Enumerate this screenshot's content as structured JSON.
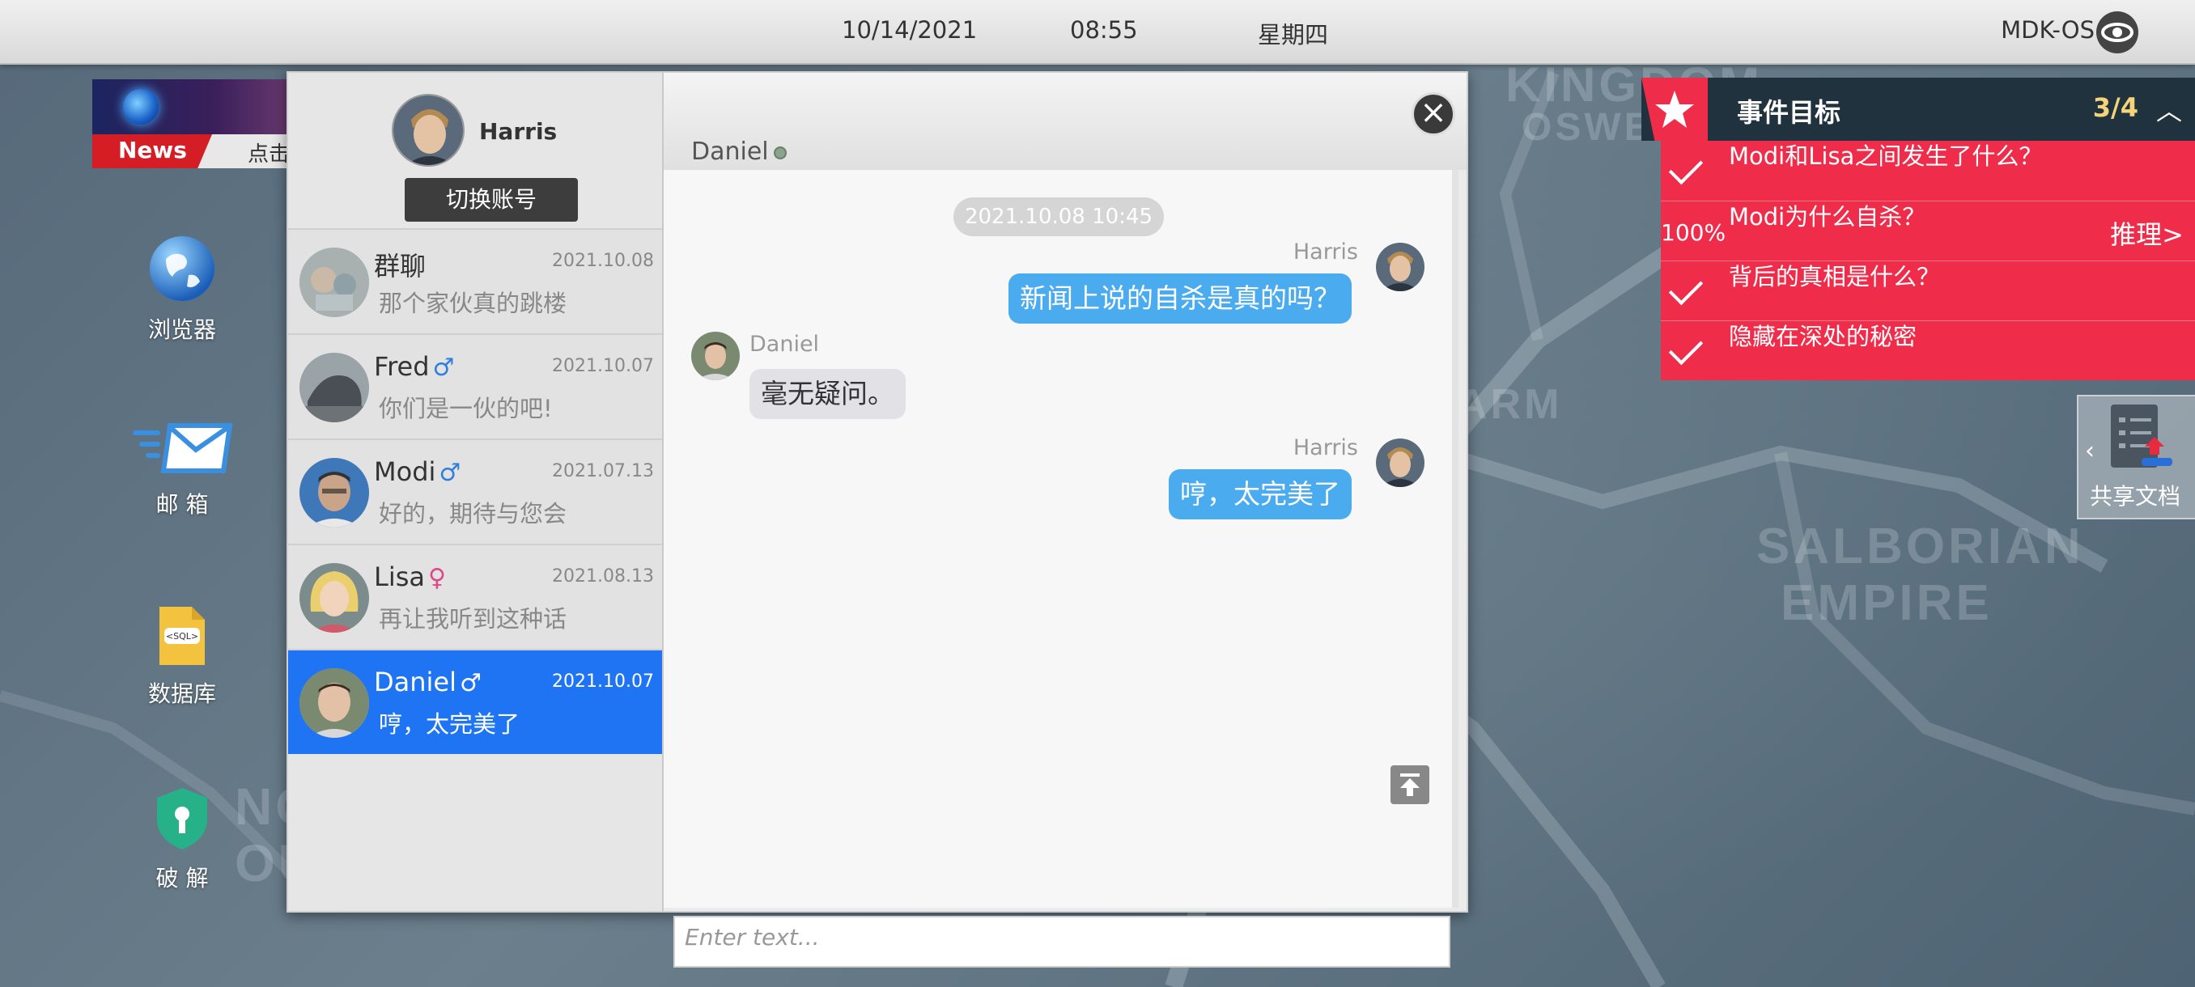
{
  "topbar": {
    "date": "10/14/2021",
    "time": "08:55",
    "weekday": "星期四",
    "os_name": "MDK-OS"
  },
  "news": {
    "label": "News",
    "click_text": "点击"
  },
  "desktop": {
    "browser": "浏览器",
    "mail": "邮 箱",
    "database": "数据库",
    "crack": "破 解",
    "sql_badge": "<SQL>"
  },
  "account": {
    "name": "Harris",
    "switch_label": "切换账号"
  },
  "contacts": [
    {
      "name": "群聊",
      "date": "2021.10.08",
      "last_msg": "那个家伙真的跳楼",
      "gender": ""
    },
    {
      "name": "Fred",
      "date": "2021.10.07",
      "last_msg": "你们是一伙的吧!",
      "gender": "♂"
    },
    {
      "name": "Modi",
      "date": "2021.07.13",
      "last_msg": "好的，期待与您会",
      "gender": "♂"
    },
    {
      "name": "Lisa",
      "date": "2021.08.13",
      "last_msg": "再让我听到这种话",
      "gender": "♀"
    },
    {
      "name": "Daniel",
      "date": "2021.10.07",
      "last_msg": "哼，太完美了",
      "gender": "♂"
    }
  ],
  "chat": {
    "title": "Daniel",
    "timestamp": "2021.10.08  10:45",
    "messages": [
      {
        "sender": "Harris",
        "text": "新闻上说的自杀是真的吗？",
        "dir": "out"
      },
      {
        "sender": "Daniel",
        "text": "毫无疑问。",
        "dir": "in"
      },
      {
        "sender": "Harris",
        "text": "哼，太完美了",
        "dir": "out"
      }
    ],
    "input_placeholder": "Enter text..."
  },
  "objectives": {
    "title": "事件目标",
    "count": "3/4",
    "progress": "100%",
    "reason_label": "推理>",
    "items": [
      {
        "text": "Modi和Lisa之间发生了什么？",
        "done": true
      },
      {
        "text": "Modi为什么自杀？",
        "done": false
      },
      {
        "text": "背后的真相是什么？",
        "done": true
      },
      {
        "text": "隐藏在深处的秘密",
        "done": true
      }
    ]
  },
  "shared_docs": {
    "label": "共享文档"
  },
  "map_labels": [
    "KINGDOM",
    "OSWEI",
    "ARM",
    "SALBORIAN",
    "EMPIRE",
    "NG",
    "OU"
  ],
  "colors": {
    "accent_red": "#ef2d4a",
    "active_blue": "#1e74f2",
    "bubble_blue": "#4aabef"
  }
}
